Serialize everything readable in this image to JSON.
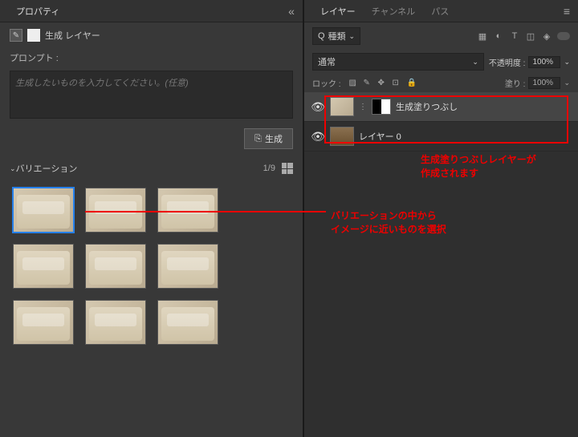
{
  "properties": {
    "tab": "プロパティ",
    "icon_pen": "✎",
    "layer_type": "生成 レイヤー",
    "prompt_label": "プロンプト :",
    "prompt_placeholder": "生成したいものを入力してください。(任意)",
    "generate_btn": "生成",
    "variations_title": "バリエーション",
    "variation_count": "1/9",
    "chevron": "⌄"
  },
  "layers": {
    "tab_layers": "レイヤー",
    "tab_channels": "チャンネル",
    "tab_paths": "パス",
    "search_prefix": "Q",
    "search_kind": "種類",
    "blend_mode": "通常",
    "opacity_label": "不透明度 :",
    "opacity_value": "100%",
    "lock_label": "ロック :",
    "fill_label": "塗り :",
    "fill_value": "100%",
    "items": [
      {
        "name": "生成塗りつぶし",
        "eye": "👁"
      },
      {
        "name": "レイヤー 0",
        "eye": "👁"
      }
    ]
  },
  "annotations": {
    "layer_note_1": "生成塗りつぶしレイヤーが",
    "layer_note_2": "作成されます",
    "variation_note_1": "バリエーションの中から",
    "variation_note_2": "イメージに近いものを選択"
  }
}
